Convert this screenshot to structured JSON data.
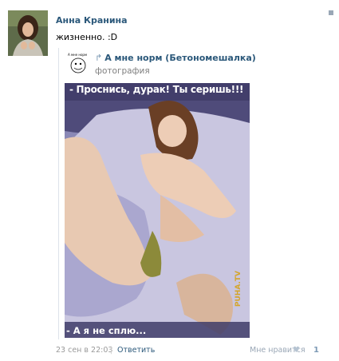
{
  "post": {
    "author": "Анна Кранина",
    "text": "жизненно. :D"
  },
  "repost": {
    "title": "А мне норм (Бетономешалка)",
    "subtitle": "фотография",
    "avatar_caption": "А мне норм",
    "image": {
      "caption_top": "- Проснись, дурак! Ты серишь!!!",
      "caption_bottom": "- А я не сплю...",
      "watermark": "PUHA.TV"
    }
  },
  "footer": {
    "date": "23 сен в 22:03",
    "reply": "Ответить",
    "like_label": "Мне нравится",
    "like_count": "1"
  },
  "colors": {
    "link": "#2b587a",
    "muted": "#999999",
    "accent": "#7d9ab5"
  },
  "icons": [
    "repost-arrow-icon",
    "heart-icon",
    "menu-icon"
  ]
}
